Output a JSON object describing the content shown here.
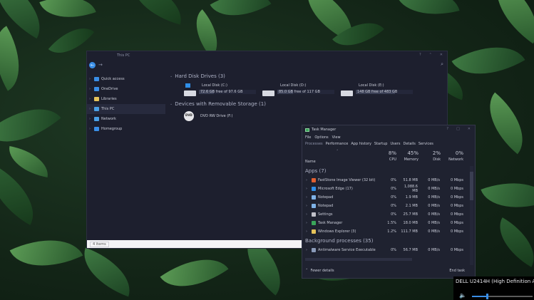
{
  "explorer": {
    "title": "This PC",
    "sidebar": [
      {
        "label": "Quick access",
        "icon": "star-icon",
        "color": "#3a8ee6",
        "active": false
      },
      {
        "label": "OneDrive",
        "icon": "cloud-icon",
        "color": "#3a8ee6",
        "active": false
      },
      {
        "label": "Libraries",
        "icon": "folder-icon",
        "color": "#e6c35a",
        "active": false
      },
      {
        "label": "This PC",
        "icon": "computer-icon",
        "color": "#4aa0e6",
        "active": true
      },
      {
        "label": "Network",
        "icon": "network-icon",
        "color": "#4aa0e6",
        "active": false
      },
      {
        "label": "Homegroup",
        "icon": "homegroup-icon",
        "color": "#3a8ee6",
        "active": false
      }
    ],
    "groups": {
      "hdd": {
        "title": "Hard Disk Drives (3)"
      },
      "removable": {
        "title": "Devices with Removable Storage (1)"
      }
    },
    "drives": [
      {
        "name": "Local Disk (C:)",
        "capacity": "72.6 GB free of 97.6 GB",
        "used_fraction": 0.26,
        "system": true
      },
      {
        "name": "Local Disk (D:)",
        "capacity": "85.0 GB free of 117 GB",
        "used_fraction": 0.27,
        "system": false
      },
      {
        "name": "Local Disk (E:)",
        "capacity": "148 GB free of 483 GB",
        "used_fraction": 0.69,
        "system": false
      }
    ],
    "dvd": {
      "name": "DVD RW Drive (F:)",
      "badge": "DVD"
    },
    "status": "4 items"
  },
  "taskmanager": {
    "title": "Task Manager",
    "menu": [
      "File",
      "Options",
      "View"
    ],
    "tabs": [
      "Processes",
      "Performance",
      "App history",
      "Startup",
      "Users",
      "Details",
      "Services"
    ],
    "columns": {
      "name": "Name",
      "cpu": {
        "pct": "8%",
        "label": "CPU"
      },
      "memory": {
        "pct": "45%",
        "label": "Memory"
      },
      "disk": {
        "pct": "2%",
        "label": "Disk"
      },
      "network": {
        "pct": "0%",
        "label": "Network"
      }
    },
    "apps_title": "Apps (7)",
    "apps": [
      {
        "name": "FastStone Image Viewer (32 bit)",
        "cpu": "0%",
        "mem": "51.8 MB",
        "disk": "0 MB/s",
        "net": "0 Mbps",
        "color": "#e06030"
      },
      {
        "name": "Microsoft Edge (17)",
        "cpu": "0%",
        "mem": "1,088.6 MB",
        "disk": "0 MB/s",
        "net": "0 Mbps",
        "color": "#2f8fe8"
      },
      {
        "name": "Notepad",
        "cpu": "0%",
        "mem": "1.9 MB",
        "disk": "0 MB/s",
        "net": "0 Mbps",
        "color": "#7fb3e8"
      },
      {
        "name": "Notepad",
        "cpu": "0%",
        "mem": "2.1 MB",
        "disk": "0 MB/s",
        "net": "0 Mbps",
        "color": "#7fb3e8"
      },
      {
        "name": "Settings",
        "cpu": "0%",
        "mem": "25.7 MB",
        "disk": "0 MB/s",
        "net": "0 Mbps",
        "color": "#c0c0c8"
      },
      {
        "name": "Task Manager",
        "cpu": "1.5%",
        "mem": "18.0 MB",
        "disk": "0 MB/s",
        "net": "0 Mbps",
        "color": "#3aa65a"
      },
      {
        "name": "Windows Explorer (3)",
        "cpu": "1.2%",
        "mem": "111.7 MB",
        "disk": "0 MB/s",
        "net": "0 Mbps",
        "color": "#e6c35a"
      }
    ],
    "bg_title": "Background processes (35)",
    "bg": [
      {
        "name": "Antimalware Service Executable",
        "cpu": "0%",
        "mem": "56.7 MB",
        "disk": "0 MB/s",
        "net": "0 Mbps",
        "color": "#8a9ab8"
      }
    ],
    "footer": {
      "fewer": "Fewer details",
      "end_task": "End task"
    }
  },
  "audio": {
    "device": "DELL U2414H (High Definition Audio D",
    "volume_fraction": 0.25
  }
}
